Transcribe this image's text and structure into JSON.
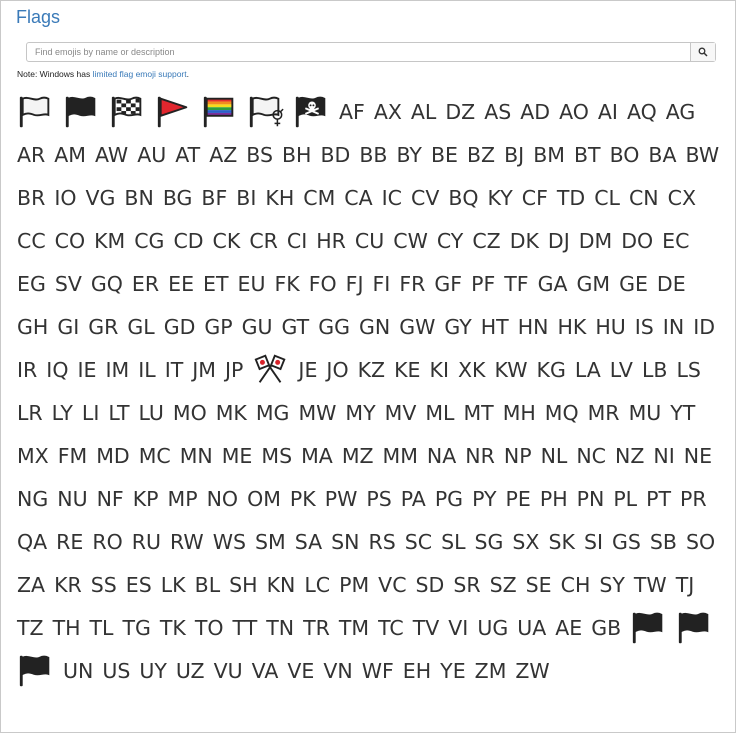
{
  "page": {
    "title": "Flags",
    "search_placeholder": "Find emojis by name or description",
    "note_prefix": "Note: Windows has ",
    "note_link": "limited flag emoji support",
    "note_suffix": "."
  },
  "flags": [
    {
      "type": "emoji",
      "name": "white-flag-icon"
    },
    {
      "type": "emoji",
      "name": "black-flag-icon"
    },
    {
      "type": "emoji",
      "name": "chequered-flag-icon"
    },
    {
      "type": "emoji",
      "name": "triangular-flag-icon"
    },
    {
      "type": "emoji",
      "name": "rainbow-flag-icon"
    },
    {
      "type": "emoji",
      "name": "transgender-flag-icon"
    },
    {
      "type": "emoji",
      "name": "pirate-flag-icon"
    },
    {
      "type": "code",
      "label": "AF"
    },
    {
      "type": "code",
      "label": "AX"
    },
    {
      "type": "code",
      "label": "AL"
    },
    {
      "type": "code",
      "label": "DZ"
    },
    {
      "type": "code",
      "label": "AS"
    },
    {
      "type": "code",
      "label": "AD"
    },
    {
      "type": "code",
      "label": "AO"
    },
    {
      "type": "code",
      "label": "AI"
    },
    {
      "type": "code",
      "label": "AQ"
    },
    {
      "type": "code",
      "label": "AG"
    },
    {
      "type": "code",
      "label": "AR"
    },
    {
      "type": "code",
      "label": "AM"
    },
    {
      "type": "code",
      "label": "AW"
    },
    {
      "type": "code",
      "label": "AU"
    },
    {
      "type": "code",
      "label": "AT"
    },
    {
      "type": "code",
      "label": "AZ"
    },
    {
      "type": "code",
      "label": "BS"
    },
    {
      "type": "code",
      "label": "BH"
    },
    {
      "type": "code",
      "label": "BD"
    },
    {
      "type": "code",
      "label": "BB"
    },
    {
      "type": "code",
      "label": "BY"
    },
    {
      "type": "code",
      "label": "BE"
    },
    {
      "type": "code",
      "label": "BZ"
    },
    {
      "type": "code",
      "label": "BJ"
    },
    {
      "type": "code",
      "label": "BM"
    },
    {
      "type": "code",
      "label": "BT"
    },
    {
      "type": "code",
      "label": "BO"
    },
    {
      "type": "code",
      "label": "BA"
    },
    {
      "type": "code",
      "label": "BW"
    },
    {
      "type": "code",
      "label": "BR"
    },
    {
      "type": "code",
      "label": "IO"
    },
    {
      "type": "code",
      "label": "VG"
    },
    {
      "type": "code",
      "label": "BN"
    },
    {
      "type": "code",
      "label": "BG"
    },
    {
      "type": "code",
      "label": "BF"
    },
    {
      "type": "code",
      "label": "BI"
    },
    {
      "type": "code",
      "label": "KH"
    },
    {
      "type": "code",
      "label": "CM"
    },
    {
      "type": "code",
      "label": "CA"
    },
    {
      "type": "code",
      "label": "IC"
    },
    {
      "type": "code",
      "label": "CV"
    },
    {
      "type": "code",
      "label": "BQ"
    },
    {
      "type": "code",
      "label": "KY"
    },
    {
      "type": "code",
      "label": "CF"
    },
    {
      "type": "code",
      "label": "TD"
    },
    {
      "type": "code",
      "label": "CL"
    },
    {
      "type": "code",
      "label": "CN"
    },
    {
      "type": "code",
      "label": "CX"
    },
    {
      "type": "code",
      "label": "CC"
    },
    {
      "type": "code",
      "label": "CO"
    },
    {
      "type": "code",
      "label": "KM"
    },
    {
      "type": "code",
      "label": "CG"
    },
    {
      "type": "code",
      "label": "CD"
    },
    {
      "type": "code",
      "label": "CK"
    },
    {
      "type": "code",
      "label": "CR"
    },
    {
      "type": "code",
      "label": "CI"
    },
    {
      "type": "code",
      "label": "HR"
    },
    {
      "type": "code",
      "label": "CU"
    },
    {
      "type": "code",
      "label": "CW"
    },
    {
      "type": "code",
      "label": "CY"
    },
    {
      "type": "code",
      "label": "CZ"
    },
    {
      "type": "code",
      "label": "DK"
    },
    {
      "type": "code",
      "label": "DJ"
    },
    {
      "type": "code",
      "label": "DM"
    },
    {
      "type": "code",
      "label": "DO"
    },
    {
      "type": "code",
      "label": "EC"
    },
    {
      "type": "code",
      "label": "EG"
    },
    {
      "type": "code",
      "label": "SV"
    },
    {
      "type": "code",
      "label": "GQ"
    },
    {
      "type": "code",
      "label": "ER"
    },
    {
      "type": "code",
      "label": "EE"
    },
    {
      "type": "code",
      "label": "ET"
    },
    {
      "type": "code",
      "label": "EU"
    },
    {
      "type": "code",
      "label": "FK"
    },
    {
      "type": "code",
      "label": "FO"
    },
    {
      "type": "code",
      "label": "FJ"
    },
    {
      "type": "code",
      "label": "FI"
    },
    {
      "type": "code",
      "label": "FR"
    },
    {
      "type": "code",
      "label": "GF"
    },
    {
      "type": "code",
      "label": "PF"
    },
    {
      "type": "code",
      "label": "TF"
    },
    {
      "type": "code",
      "label": "GA"
    },
    {
      "type": "code",
      "label": "GM"
    },
    {
      "type": "code",
      "label": "GE"
    },
    {
      "type": "code",
      "label": "DE"
    },
    {
      "type": "code",
      "label": "GH"
    },
    {
      "type": "code",
      "label": "GI"
    },
    {
      "type": "code",
      "label": "GR"
    },
    {
      "type": "code",
      "label": "GL"
    },
    {
      "type": "code",
      "label": "GD"
    },
    {
      "type": "code",
      "label": "GP"
    },
    {
      "type": "code",
      "label": "GU"
    },
    {
      "type": "code",
      "label": "GT"
    },
    {
      "type": "code",
      "label": "GG"
    },
    {
      "type": "code",
      "label": "GN"
    },
    {
      "type": "code",
      "label": "GW"
    },
    {
      "type": "code",
      "label": "GY"
    },
    {
      "type": "code",
      "label": "HT"
    },
    {
      "type": "code",
      "label": "HN"
    },
    {
      "type": "code",
      "label": "HK"
    },
    {
      "type": "code",
      "label": "HU"
    },
    {
      "type": "code",
      "label": "IS"
    },
    {
      "type": "code",
      "label": "IN"
    },
    {
      "type": "code",
      "label": "ID"
    },
    {
      "type": "code",
      "label": "IR"
    },
    {
      "type": "code",
      "label": "IQ"
    },
    {
      "type": "code",
      "label": "IE"
    },
    {
      "type": "code",
      "label": "IM"
    },
    {
      "type": "code",
      "label": "IL"
    },
    {
      "type": "code",
      "label": "IT"
    },
    {
      "type": "code",
      "label": "JM"
    },
    {
      "type": "code",
      "label": "JP"
    },
    {
      "type": "emoji",
      "name": "crossed-flags-icon"
    },
    {
      "type": "code",
      "label": "JE"
    },
    {
      "type": "code",
      "label": "JO"
    },
    {
      "type": "code",
      "label": "KZ"
    },
    {
      "type": "code",
      "label": "KE"
    },
    {
      "type": "code",
      "label": "KI"
    },
    {
      "type": "code",
      "label": "XK"
    },
    {
      "type": "code",
      "label": "KW"
    },
    {
      "type": "code",
      "label": "KG"
    },
    {
      "type": "code",
      "label": "LA"
    },
    {
      "type": "code",
      "label": "LV"
    },
    {
      "type": "code",
      "label": "LB"
    },
    {
      "type": "code",
      "label": "LS"
    },
    {
      "type": "code",
      "label": "LR"
    },
    {
      "type": "code",
      "label": "LY"
    },
    {
      "type": "code",
      "label": "LI"
    },
    {
      "type": "code",
      "label": "LT"
    },
    {
      "type": "code",
      "label": "LU"
    },
    {
      "type": "code",
      "label": "MO"
    },
    {
      "type": "code",
      "label": "MK"
    },
    {
      "type": "code",
      "label": "MG"
    },
    {
      "type": "code",
      "label": "MW"
    },
    {
      "type": "code",
      "label": "MY"
    },
    {
      "type": "code",
      "label": "MV"
    },
    {
      "type": "code",
      "label": "ML"
    },
    {
      "type": "code",
      "label": "MT"
    },
    {
      "type": "code",
      "label": "MH"
    },
    {
      "type": "code",
      "label": "MQ"
    },
    {
      "type": "code",
      "label": "MR"
    },
    {
      "type": "code",
      "label": "MU"
    },
    {
      "type": "code",
      "label": "YT"
    },
    {
      "type": "code",
      "label": "MX"
    },
    {
      "type": "code",
      "label": "FM"
    },
    {
      "type": "code",
      "label": "MD"
    },
    {
      "type": "code",
      "label": "MC"
    },
    {
      "type": "code",
      "label": "MN"
    },
    {
      "type": "code",
      "label": "ME"
    },
    {
      "type": "code",
      "label": "MS"
    },
    {
      "type": "code",
      "label": "MA"
    },
    {
      "type": "code",
      "label": "MZ"
    },
    {
      "type": "code",
      "label": "MM"
    },
    {
      "type": "code",
      "label": "NA"
    },
    {
      "type": "code",
      "label": "NR"
    },
    {
      "type": "code",
      "label": "NP"
    },
    {
      "type": "code",
      "label": "NL"
    },
    {
      "type": "code",
      "label": "NC"
    },
    {
      "type": "code",
      "label": "NZ"
    },
    {
      "type": "code",
      "label": "NI"
    },
    {
      "type": "code",
      "label": "NE"
    },
    {
      "type": "code",
      "label": "NG"
    },
    {
      "type": "code",
      "label": "NU"
    },
    {
      "type": "code",
      "label": "NF"
    },
    {
      "type": "code",
      "label": "KP"
    },
    {
      "type": "code",
      "label": "MP"
    },
    {
      "type": "code",
      "label": "NO"
    },
    {
      "type": "code",
      "label": "OM"
    },
    {
      "type": "code",
      "label": "PK"
    },
    {
      "type": "code",
      "label": "PW"
    },
    {
      "type": "code",
      "label": "PS"
    },
    {
      "type": "code",
      "label": "PA"
    },
    {
      "type": "code",
      "label": "PG"
    },
    {
      "type": "code",
      "label": "PY"
    },
    {
      "type": "code",
      "label": "PE"
    },
    {
      "type": "code",
      "label": "PH"
    },
    {
      "type": "code",
      "label": "PN"
    },
    {
      "type": "code",
      "label": "PL"
    },
    {
      "type": "code",
      "label": "PT"
    },
    {
      "type": "code",
      "label": "PR"
    },
    {
      "type": "code",
      "label": "QA"
    },
    {
      "type": "code",
      "label": "RE"
    },
    {
      "type": "code",
      "label": "RO"
    },
    {
      "type": "code",
      "label": "RU"
    },
    {
      "type": "code",
      "label": "RW"
    },
    {
      "type": "code",
      "label": "WS"
    },
    {
      "type": "code",
      "label": "SM"
    },
    {
      "type": "code",
      "label": "SA"
    },
    {
      "type": "code",
      "label": "SN"
    },
    {
      "type": "code",
      "label": "RS"
    },
    {
      "type": "code",
      "label": "SC"
    },
    {
      "type": "code",
      "label": "SL"
    },
    {
      "type": "code",
      "label": "SG"
    },
    {
      "type": "code",
      "label": "SX"
    },
    {
      "type": "code",
      "label": "SK"
    },
    {
      "type": "code",
      "label": "SI"
    },
    {
      "type": "code",
      "label": "GS"
    },
    {
      "type": "code",
      "label": "SB"
    },
    {
      "type": "code",
      "label": "SO"
    },
    {
      "type": "code",
      "label": "ZA"
    },
    {
      "type": "code",
      "label": "KR"
    },
    {
      "type": "code",
      "label": "SS"
    },
    {
      "type": "code",
      "label": "ES"
    },
    {
      "type": "code",
      "label": "LK"
    },
    {
      "type": "code",
      "label": "BL"
    },
    {
      "type": "code",
      "label": "SH"
    },
    {
      "type": "code",
      "label": "KN"
    },
    {
      "type": "code",
      "label": "LC"
    },
    {
      "type": "code",
      "label": "PM"
    },
    {
      "type": "code",
      "label": "VC"
    },
    {
      "type": "code",
      "label": "SD"
    },
    {
      "type": "code",
      "label": "SR"
    },
    {
      "type": "code",
      "label": "SZ"
    },
    {
      "type": "code",
      "label": "SE"
    },
    {
      "type": "code",
      "label": "CH"
    },
    {
      "type": "code",
      "label": "SY"
    },
    {
      "type": "code",
      "label": "TW"
    },
    {
      "type": "code",
      "label": "TJ"
    },
    {
      "type": "code",
      "label": "TZ"
    },
    {
      "type": "code",
      "label": "TH"
    },
    {
      "type": "code",
      "label": "TL"
    },
    {
      "type": "code",
      "label": "TG"
    },
    {
      "type": "code",
      "label": "TK"
    },
    {
      "type": "code",
      "label": "TO"
    },
    {
      "type": "code",
      "label": "TT"
    },
    {
      "type": "code",
      "label": "TN"
    },
    {
      "type": "code",
      "label": "TR"
    },
    {
      "type": "code",
      "label": "TM"
    },
    {
      "type": "code",
      "label": "TC"
    },
    {
      "type": "code",
      "label": "TV"
    },
    {
      "type": "code",
      "label": "VI"
    },
    {
      "type": "code",
      "label": "UG"
    },
    {
      "type": "code",
      "label": "UA"
    },
    {
      "type": "code",
      "label": "AE"
    },
    {
      "type": "code",
      "label": "GB"
    },
    {
      "type": "emoji",
      "name": "black-flag-icon"
    },
    {
      "type": "emoji",
      "name": "black-flag-icon"
    },
    {
      "type": "emoji",
      "name": "black-flag-icon"
    },
    {
      "type": "code",
      "label": "UN"
    },
    {
      "type": "code",
      "label": "US"
    },
    {
      "type": "code",
      "label": "UY"
    },
    {
      "type": "code",
      "label": "UZ"
    },
    {
      "type": "code",
      "label": "VU"
    },
    {
      "type": "code",
      "label": "VA"
    },
    {
      "type": "code",
      "label": "VE"
    },
    {
      "type": "code",
      "label": "VN"
    },
    {
      "type": "code",
      "label": "WF"
    },
    {
      "type": "code",
      "label": "EH"
    },
    {
      "type": "code",
      "label": "YE"
    },
    {
      "type": "code",
      "label": "ZM"
    },
    {
      "type": "code",
      "label": "ZW"
    }
  ]
}
